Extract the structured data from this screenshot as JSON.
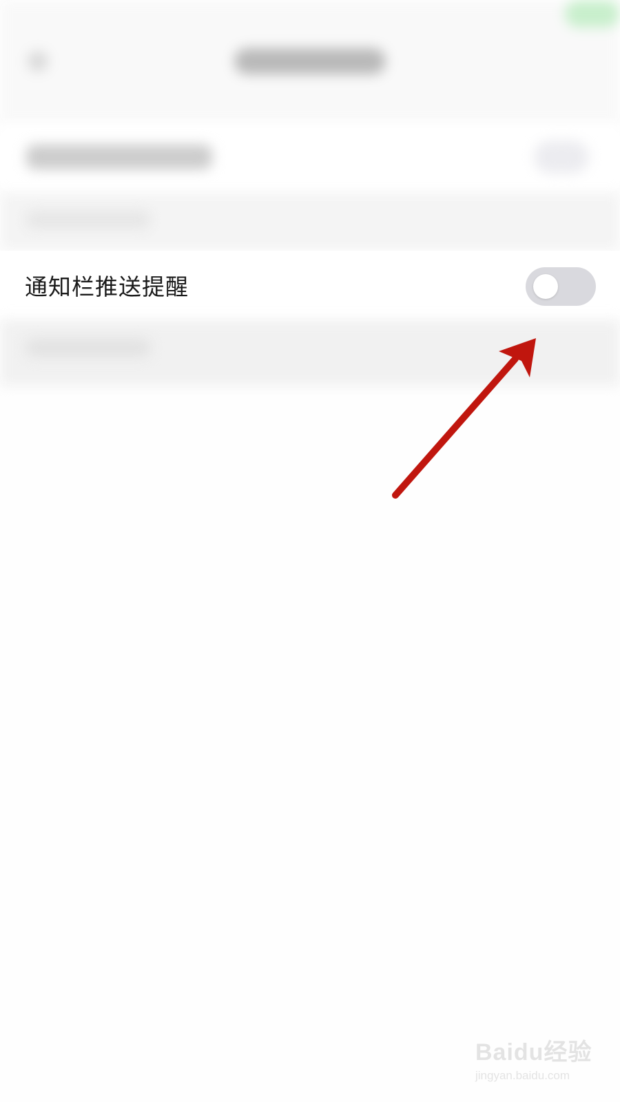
{
  "setting": {
    "label": "通知栏推送提醒",
    "toggle_state": "off"
  },
  "annotation": {
    "type": "red-arrow",
    "color": "#c0160e",
    "points_to": "toggle-switch"
  },
  "watermark": {
    "logo": "Baidu经验",
    "url": "jingyan.baidu.com"
  },
  "colors": {
    "toggle_off_track": "#d9d9de",
    "toggle_knob": "#ffffff",
    "label_text": "#1a1a1a"
  }
}
